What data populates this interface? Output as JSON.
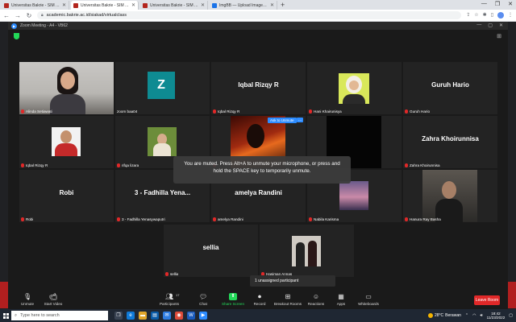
{
  "browser": {
    "tabs": [
      {
        "title": "Universitas Bakrie - SIM Akademi",
        "active": false
      },
      {
        "title": "Universitas Bakrie - SIM Akadem",
        "active": true
      },
      {
        "title": "Universitas Bakrie - SIM Akadem",
        "active": false
      },
      {
        "title": "ImgBB — Upload Image — Free",
        "active": false
      }
    ],
    "new_tab": "+",
    "url": "academic.bakrie.ac.id/siakad/virtualclass"
  },
  "zoom": {
    "window_title": "Zoom Meeting - A4 - VB62",
    "participants": [
      {
        "name": "Alinda Setiawati",
        "big": "",
        "speaking": true,
        "muted": true
      },
      {
        "name": "zoom baa04",
        "big": "",
        "avatar_letter": "Z",
        "muted": false
      },
      {
        "name": "Iqbal Rizqy R",
        "big": "Iqbal Rizqy R",
        "muted": true
      },
      {
        "name": "Hani Khairunisya",
        "big": "",
        "muted": true
      },
      {
        "name": "Guruh Hario",
        "big": "Guruh Hario",
        "muted": true
      },
      {
        "name": "Iqbal Rizqy R",
        "big": "",
        "muted": true
      },
      {
        "name": "rifqa lizara",
        "big": "",
        "muted": true
      },
      {
        "name": "",
        "big": "",
        "muted": true
      },
      {
        "name": "",
        "big": "",
        "muted": true
      },
      {
        "name": "Zahra Khoirunnisa",
        "big": "Zahra Khoirunnisa",
        "muted": true
      },
      {
        "name": "Robi",
        "big": "Robi",
        "muted": true
      },
      {
        "name": "3 - Fadhilla Yenasywaputri",
        "big": "3 - Fadhilla Yena...",
        "muted": true
      },
      {
        "name": "amelya Randini",
        "big": "amelya Randini",
        "muted": true
      },
      {
        "name": "Nabila Karisma",
        "big": "",
        "muted": true
      },
      {
        "name": "Hanura Ray Basha",
        "big": "",
        "muted": true
      },
      {
        "name": "sellia",
        "big": "sellia",
        "muted": true
      },
      {
        "name": "Hasiman Annas",
        "big": "",
        "muted": true
      }
    ],
    "ask_to_unmute": "Ask to Unmute",
    "more": "...",
    "muted_message": "You are muted. Press Alt+A to unmute your microphone, or press and hold the SPACE key to temporarily unmute.",
    "unassigned": "1 unassigned participant",
    "toolbar": {
      "unmute": "Unmute",
      "start_video": "Start Video",
      "participants": "Participants",
      "participants_count": "17",
      "chat": "Chat",
      "share_screen": "Share Screen",
      "record": "Record",
      "breakout_rooms": "Breakout Rooms",
      "reactions": "Reactions",
      "apps": "Apps",
      "whiteboards": "Whiteboards",
      "leave_room": "Leave Room"
    }
  },
  "taskbar": {
    "search_placeholder": "Type here to search",
    "weather_temp": "28°C",
    "weather_desc": "Berawan",
    "time": "18:42",
    "date": "11/23/2022"
  },
  "colors": {
    "zoom_blue": "#2d8cff",
    "leave_red": "#e02828",
    "share_green": "#23d959",
    "speaker_outline": "#e8e46a"
  }
}
